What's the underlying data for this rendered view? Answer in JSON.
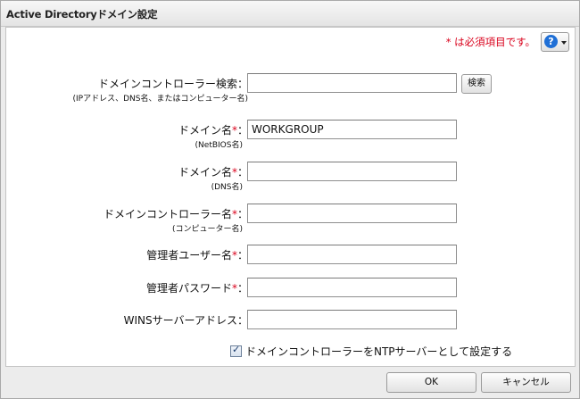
{
  "window": {
    "title": "Active Directoryドメイン設定"
  },
  "header": {
    "required_note_star": "*",
    "required_note_text": " は必須項目です。",
    "help_icon": "question-circle-icon"
  },
  "form": {
    "dc_search": {
      "label": "ドメインコントローラー検索：",
      "sublabel": "(IPアドレス、DNS名、またはコンピューター名)",
      "value": "",
      "button": "検索"
    },
    "netbios_name": {
      "label": "ドメイン名",
      "star": "*",
      "colon": "：",
      "sublabel": "(NetBIOS名)",
      "value": "WORKGROUP"
    },
    "dns_name": {
      "label": "ドメイン名",
      "star": "*",
      "colon": "：",
      "sublabel": "(DNS名)",
      "value": ""
    },
    "dc_name": {
      "label": "ドメインコントローラー名",
      "star": "*",
      "colon": "：",
      "sublabel": "(コンピューター名)",
      "value": ""
    },
    "admin_user": {
      "label": "管理者ユーザー名",
      "star": "*",
      "colon": "：",
      "value": ""
    },
    "admin_password": {
      "label": "管理者パスワード",
      "star": "*",
      "colon": "：",
      "value": ""
    },
    "wins_address": {
      "label": "WINSサーバーアドレス：",
      "value": ""
    },
    "ntp_checkbox": {
      "label": "ドメインコントローラーをNTPサーバーとして設定する",
      "checked": true
    }
  },
  "footer": {
    "ok": "OK",
    "cancel": "キャンセル"
  }
}
